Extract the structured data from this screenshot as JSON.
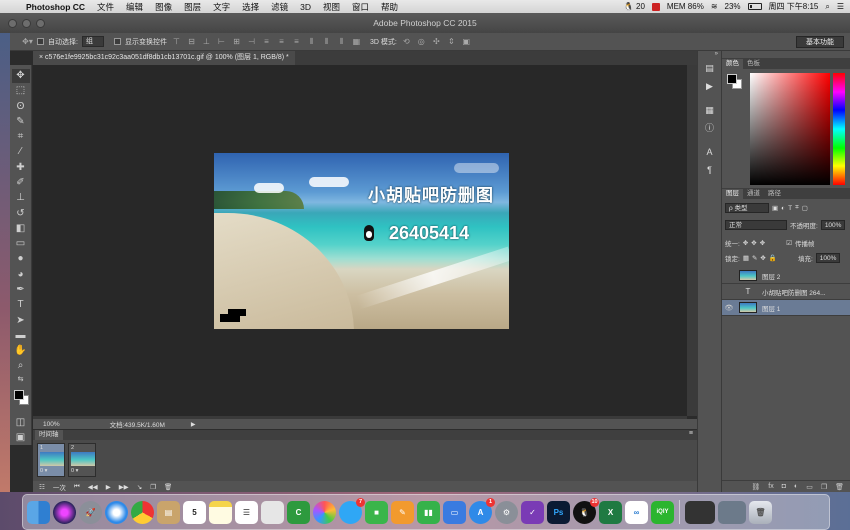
{
  "menubar": {
    "app_name": "Photoshop CC",
    "menus": [
      "文件",
      "编辑",
      "图像",
      "图层",
      "文字",
      "选择",
      "滤镜",
      "3D",
      "视图",
      "窗口",
      "帮助"
    ],
    "status": {
      "qq_count": "20",
      "mem": "MEM 86%",
      "battery": "23%",
      "battery_level": 0.23,
      "clock": "周四 下午8:15"
    }
  },
  "window": {
    "title": "Adobe Photoshop CC 2015"
  },
  "options_bar": {
    "auto_select_label": "自动选择:",
    "auto_select_value": "组",
    "show_transform_label": "显示变换控件",
    "mode_3d_label": "3D 模式:",
    "workspace": "基本功能"
  },
  "document": {
    "tab_title": "c576e1fe9925bc31c92c3aa051df8db1cb13701c.gif @ 100% (图层 1, RGB/8) *",
    "watermark_title": "小胡贴吧防删图",
    "watermark_number": "26405414"
  },
  "status_bar": {
    "zoom": "100%",
    "doc_size": "文档:439.5K/1.60M"
  },
  "timeline": {
    "tab": "时间轴",
    "frames": [
      {
        "num": "1",
        "duration": "0 ▾"
      },
      {
        "num": "2",
        "duration": "0 ▾"
      }
    ],
    "loop": "一次"
  },
  "color_panel": {
    "tabs": [
      "颜色",
      "色板"
    ]
  },
  "layers_panel": {
    "tabs": [
      "图层",
      "通道",
      "路径"
    ],
    "kind_filter": "ρ 类型",
    "blend_mode": "正常",
    "opacity_label": "不透明度:",
    "opacity_value": "100%",
    "unify_label": "统一:",
    "propagate_label": "传播帧",
    "lock_label": "锁定:",
    "fill_label": "填充:",
    "fill_value": "100%",
    "layers": [
      {
        "name": "图层 2",
        "type": "image"
      },
      {
        "name": "小胡贴吧防删图  264...",
        "type": "text"
      },
      {
        "name": "图层 1",
        "type": "image",
        "selected": true
      }
    ]
  },
  "dock": {
    "badges": {
      "appstore": "1",
      "qq": "10",
      "mail": "7"
    }
  },
  "colors": {
    "accent": "#6a7b95",
    "panel": "#535353",
    "canvas": "#282828"
  }
}
